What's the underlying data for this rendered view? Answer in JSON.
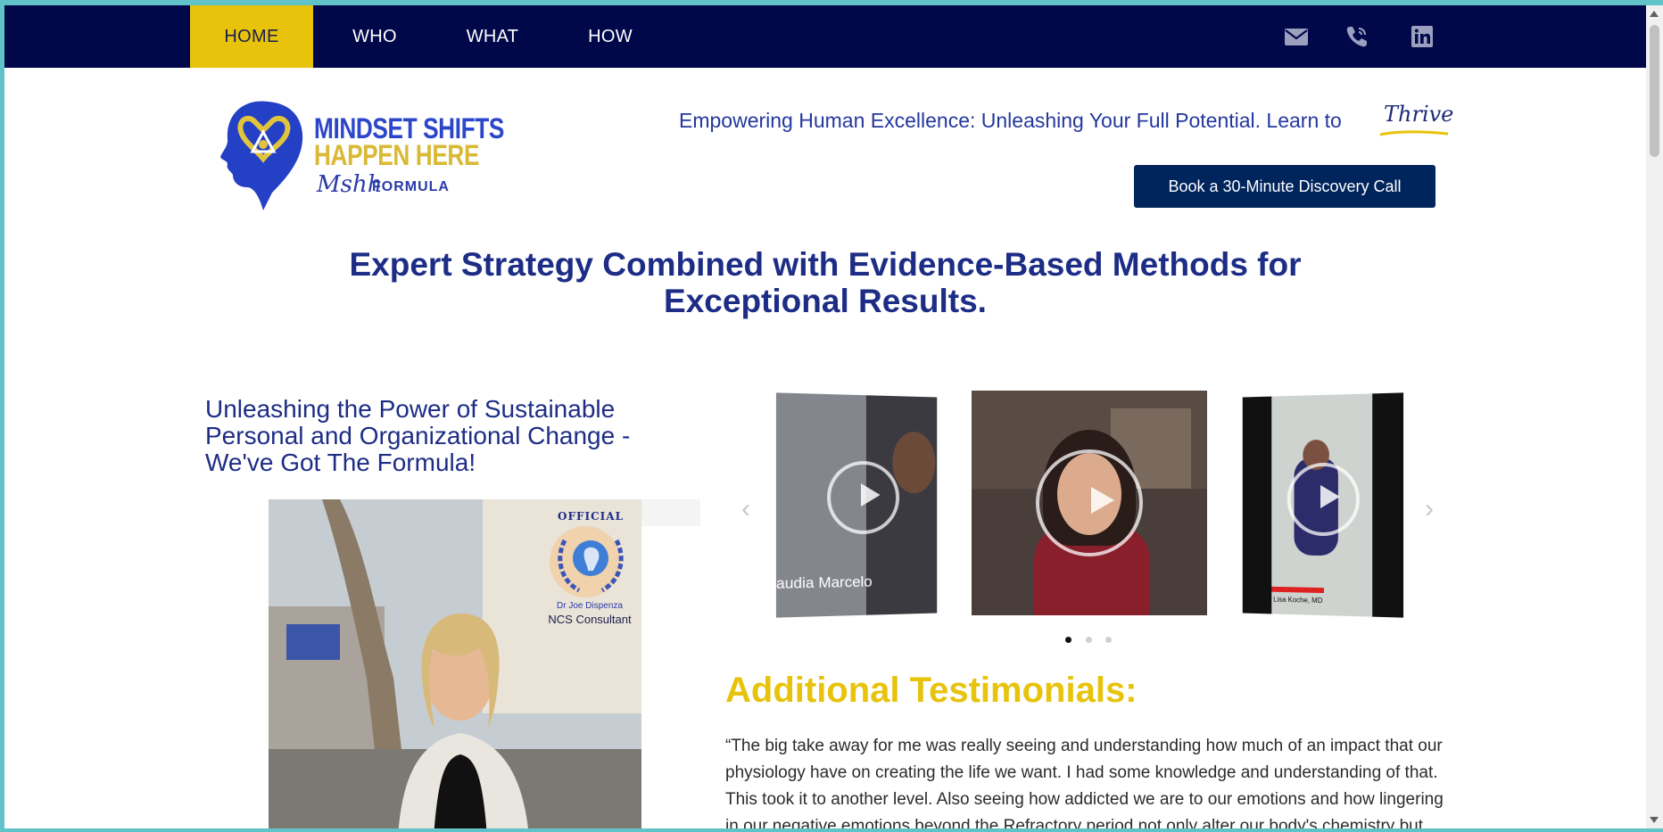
{
  "nav": {
    "items": [
      {
        "label": "HOME",
        "active": true
      },
      {
        "label": "WHO",
        "active": false
      },
      {
        "label": "WHAT",
        "active": false
      },
      {
        "label": "HOW",
        "active": false
      }
    ],
    "icons": [
      "envelope-icon",
      "phone-icon",
      "linkedin-icon"
    ]
  },
  "logo": {
    "line1": "MINDSET SHIFTS",
    "line2": "HAPPEN HERE",
    "script": "Mshh",
    "formula": "FORMULA"
  },
  "header": {
    "tagline": "Empowering Human Excellence: Unleashing Your Full Potential. Learn to",
    "tagline_script": "Thrive",
    "cta_label": "Book a 30-Minute Discovery Call"
  },
  "main": {
    "headline": "Expert Strategy Combined with Evidence-Based Methods for Exceptional Results.",
    "sub_headline": "Unleashing the Power of Sustainable Personal and Organizational Change - We've Got The Formula!",
    "badge": {
      "official": "OFFICIAL",
      "line1": "Dr Joe Dispenza",
      "line2": "NCS Consultant"
    }
  },
  "carousel": {
    "slides": [
      {
        "caption": "audia Marcelo"
      },
      {
        "caption": ""
      },
      {
        "caption": "Lisa Koche, MD"
      }
    ],
    "active_index": 0,
    "dot_count": 3
  },
  "testimonials": {
    "title": "Additional Testimonials:",
    "text": "“The big take away for me was really seeing and understanding how much of an impact that our physiology have on creating the life we want. I had some knowledge and understanding of that. This took it to another level. Also seeing how addicted we are to our emotions and how lingering in our negative emotions beyond the Refractory period not only alter our body's chemistry but also our"
  },
  "colors": {
    "nav_bg": "#00084a",
    "accent_yellow": "#e7c30c",
    "brand_blue": "#1d2d86",
    "cta_bg": "#00245c"
  }
}
